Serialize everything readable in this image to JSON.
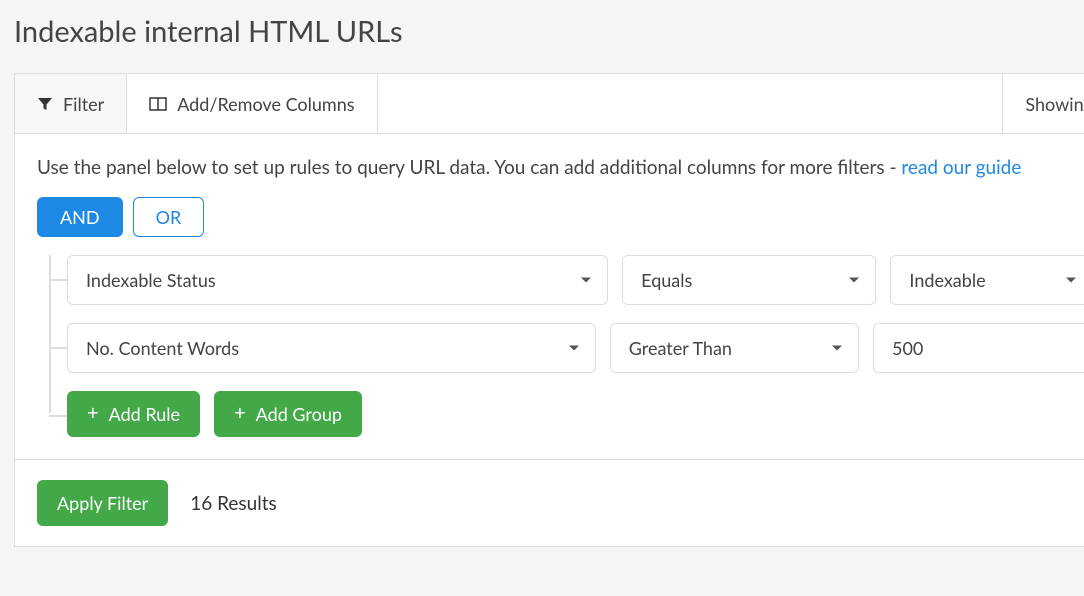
{
  "page_title": "Indexable internal HTML URLs",
  "tabs": {
    "filter": "Filter",
    "columns": "Add/Remove Columns"
  },
  "showing_label": "Showing",
  "intro_text": "Use the panel below to set up rules to query URL data. You can add additional columns for more filters - ",
  "intro_link": "read our guide",
  "logic": {
    "and": "AND",
    "or": "OR"
  },
  "rules": [
    {
      "field": "Indexable Status",
      "operator": "Equals",
      "value": "Indexable",
      "value_kind": "select"
    },
    {
      "field": "No. Content Words",
      "operator": "Greater Than",
      "value": "500",
      "value_kind": "text"
    }
  ],
  "buttons": {
    "add_rule": "Add Rule",
    "add_group": "Add Group",
    "apply": "Apply Filter"
  },
  "results_text": "16 Results"
}
